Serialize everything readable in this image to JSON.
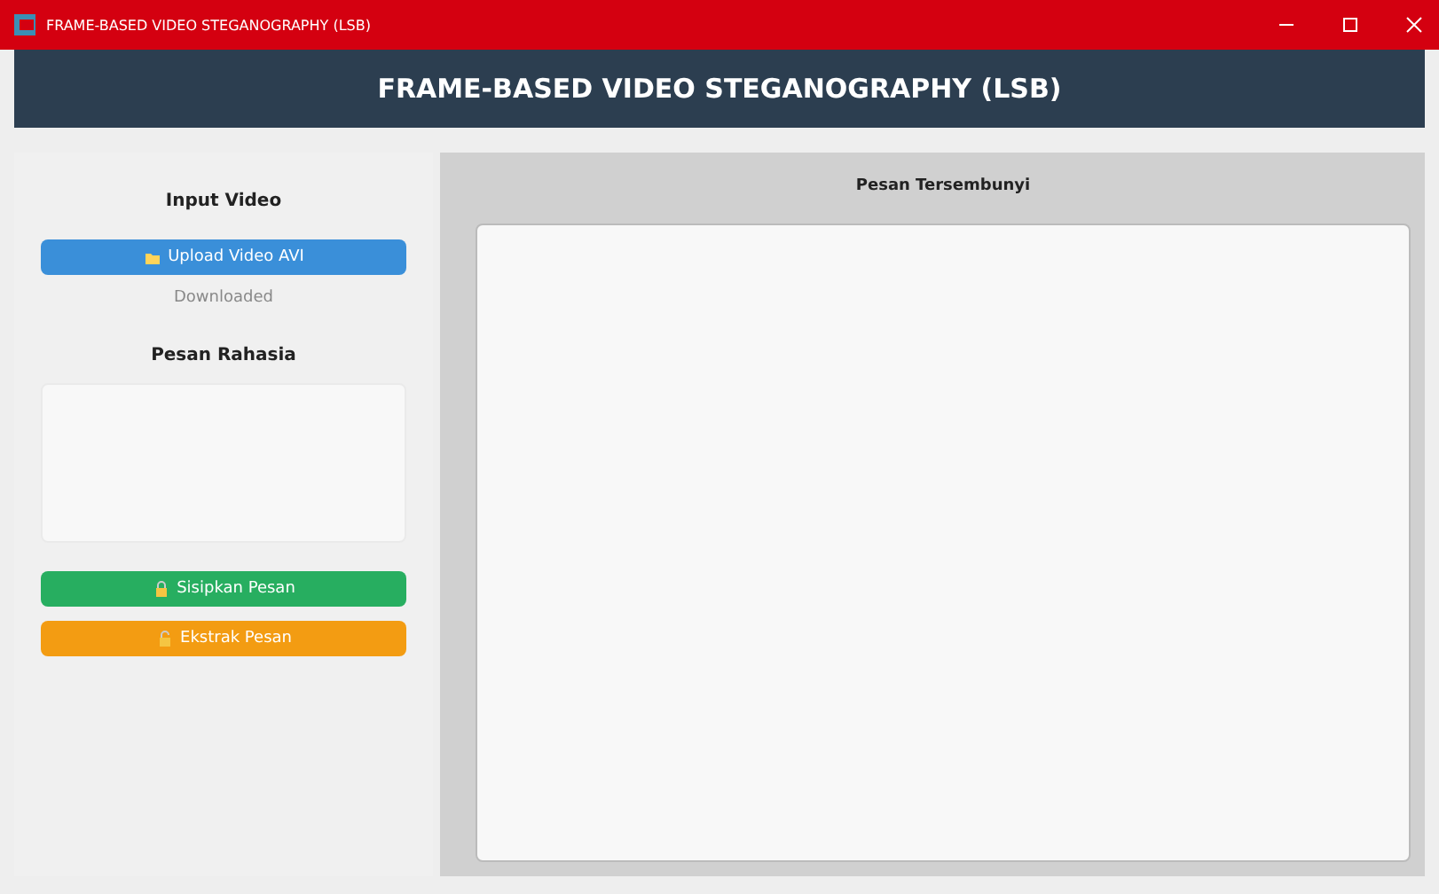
{
  "window": {
    "title": "FRAME-BASED VIDEO STEGANOGRAPHY (LSB)"
  },
  "header": {
    "title": "FRAME-BASED VIDEO STEGANOGRAPHY (LSB)"
  },
  "left_panel": {
    "input_heading": "Input Video",
    "upload_button": "Upload Video AVI",
    "file_status": "Downloaded",
    "message_heading": "Pesan Rahasia",
    "buttons": [
      {
        "label": "Sisipkan Pesan",
        "kind": "embed"
      },
      {
        "label": "Ekstrak Pesan",
        "kind": "extract"
      }
    ]
  },
  "right_panel": {
    "heading": "Pesan Tersembunyi"
  }
}
